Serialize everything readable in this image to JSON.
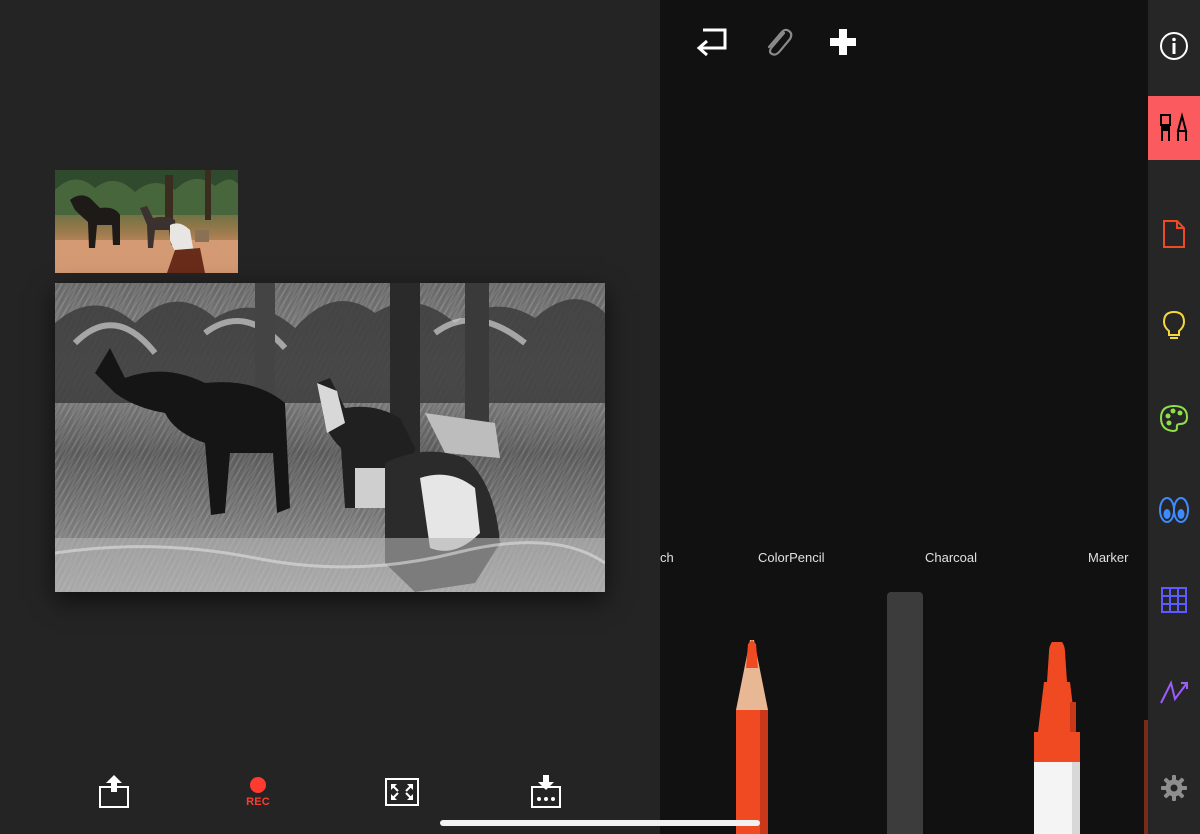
{
  "brushes": {
    "items": [
      {
        "label": "ch"
      },
      {
        "label": "ColorPencil"
      },
      {
        "label": "Charcoal"
      },
      {
        "label": "Marker"
      }
    ]
  },
  "bottom_toolbar": {
    "rec_label": "REC"
  },
  "colors": {
    "accent": "#fb5a5e",
    "record": "#ff3b30",
    "pencil": "#f04a22",
    "lightbulb": "#f5d63b",
    "palette": "#8ee04a",
    "eyes": "#3d8bff",
    "grid": "#5b5bff",
    "zigzag": "#9c5cff"
  },
  "icons": {
    "share": "share-icon",
    "record": "record-icon",
    "fit": "fit-screen-icon",
    "import": "import-icon",
    "undo": "undo-icon",
    "attach": "paperclip-icon",
    "add": "plus-icon",
    "info": "info-icon",
    "brushes": "brushes-icon",
    "page": "page-icon",
    "ideas": "lightbulb-icon",
    "palette": "palette-icon",
    "eyes": "eyes-icon",
    "grid": "grid-icon",
    "zigzag": "zigzag-icon",
    "settings": "gear-icon"
  }
}
